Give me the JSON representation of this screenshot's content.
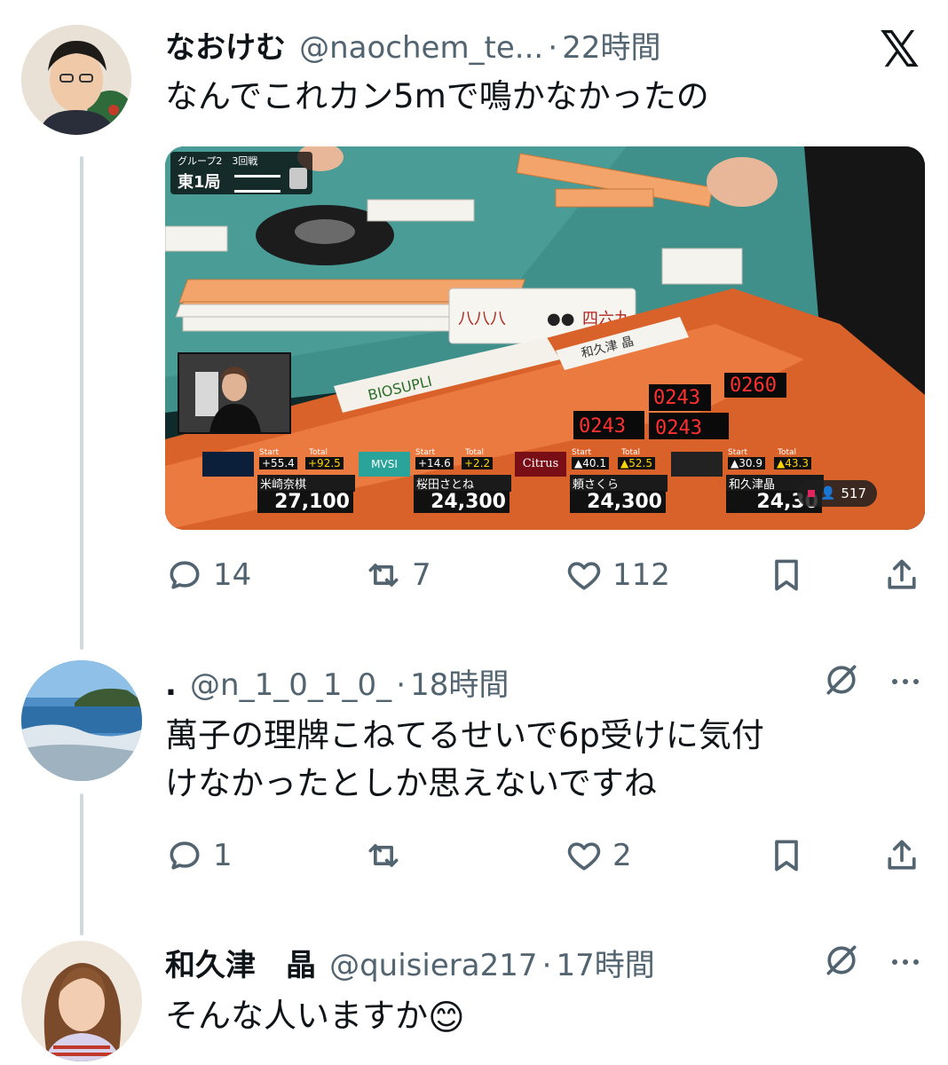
{
  "tweets": [
    {
      "name": "なおけむ",
      "handle": "@naochem_te...",
      "time": "22時間",
      "text": "なんでこれカン5mで鳴かなかったの",
      "media": {
        "overlay": {
          "group_round": "グループ2　3回戦",
          "round": "東1局",
          "viewers": "517",
          "sponsor_logo": "BIOSUPLI",
          "table_name": "和久津 晶",
          "counter_values": [
            "0243",
            "0243",
            "0243",
            "0260"
          ],
          "players": [
            {
              "team_logo": "",
              "start_label": "Start",
              "start": "+55.4",
              "total_label": "Total",
              "total": "+92.5",
              "name": "米崎奈棋",
              "score": "27,100"
            },
            {
              "team_logo": "MVSI",
              "start_label": "Start",
              "start": "+14.6",
              "total_label": "Total",
              "total": "+2.2",
              "name": "桜田さとね",
              "score": "24,300"
            },
            {
              "team_logo": "Citrus",
              "start_label": "Start",
              "start": "▲40.1",
              "total_label": "Total",
              "total": "▲52.5",
              "name": "頼さくら",
              "score": "24,300"
            },
            {
              "team_logo": "",
              "start_label": "Start",
              "start": "▲30.9",
              "total_label": "Total",
              "total": "▲43.3",
              "name": "和久津晶",
              "score": "24,30"
            }
          ]
        }
      },
      "actions": {
        "replies": "14",
        "retweets": "7",
        "likes": "112"
      }
    },
    {
      "name": ".",
      "handle": "@n_1_0_1_0_",
      "time": "18時間",
      "text_lines": [
        "萬子の理牌こねてるせいで6p受けに気付",
        "けなかったとしか思えないですね"
      ],
      "actions": {
        "replies": "1",
        "retweets": "",
        "likes": "2"
      }
    },
    {
      "name": "和久津　晶",
      "handle": "@quisiera217",
      "time": "17時間",
      "text": "そんな人いますか",
      "emoji": "😊"
    }
  ],
  "separator": "·",
  "colors": {
    "text": "#0f1419",
    "secondary": "#536471",
    "line": "#cfd9de"
  },
  "icons": [
    "x-logo-icon",
    "reply-icon",
    "retweet-icon",
    "like-icon",
    "bookmark-icon",
    "share-icon",
    "grok-icon",
    "more-icon"
  ]
}
